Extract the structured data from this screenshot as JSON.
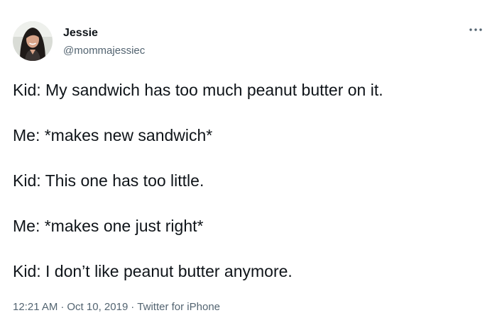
{
  "author": {
    "display_name": "Jessie",
    "handle": "@mommajessiec"
  },
  "icons": {
    "avatar": "avatar-photo",
    "more": "more-dots-icon"
  },
  "tweet": {
    "lines": [
      "Kid: My sandwich has too much peanut butter on it.",
      "Me: *makes new sandwich*",
      "Kid: This one has too little.",
      "Me: *makes one just right*",
      "Kid: I don’t like peanut butter anymore."
    ]
  },
  "meta": {
    "time": "12:21 AM",
    "separator": "·",
    "date": "Oct 10, 2019",
    "source": "Twitter for iPhone"
  },
  "colors": {
    "text": "#0f1419",
    "secondary": "#536471",
    "background": "#ffffff"
  }
}
